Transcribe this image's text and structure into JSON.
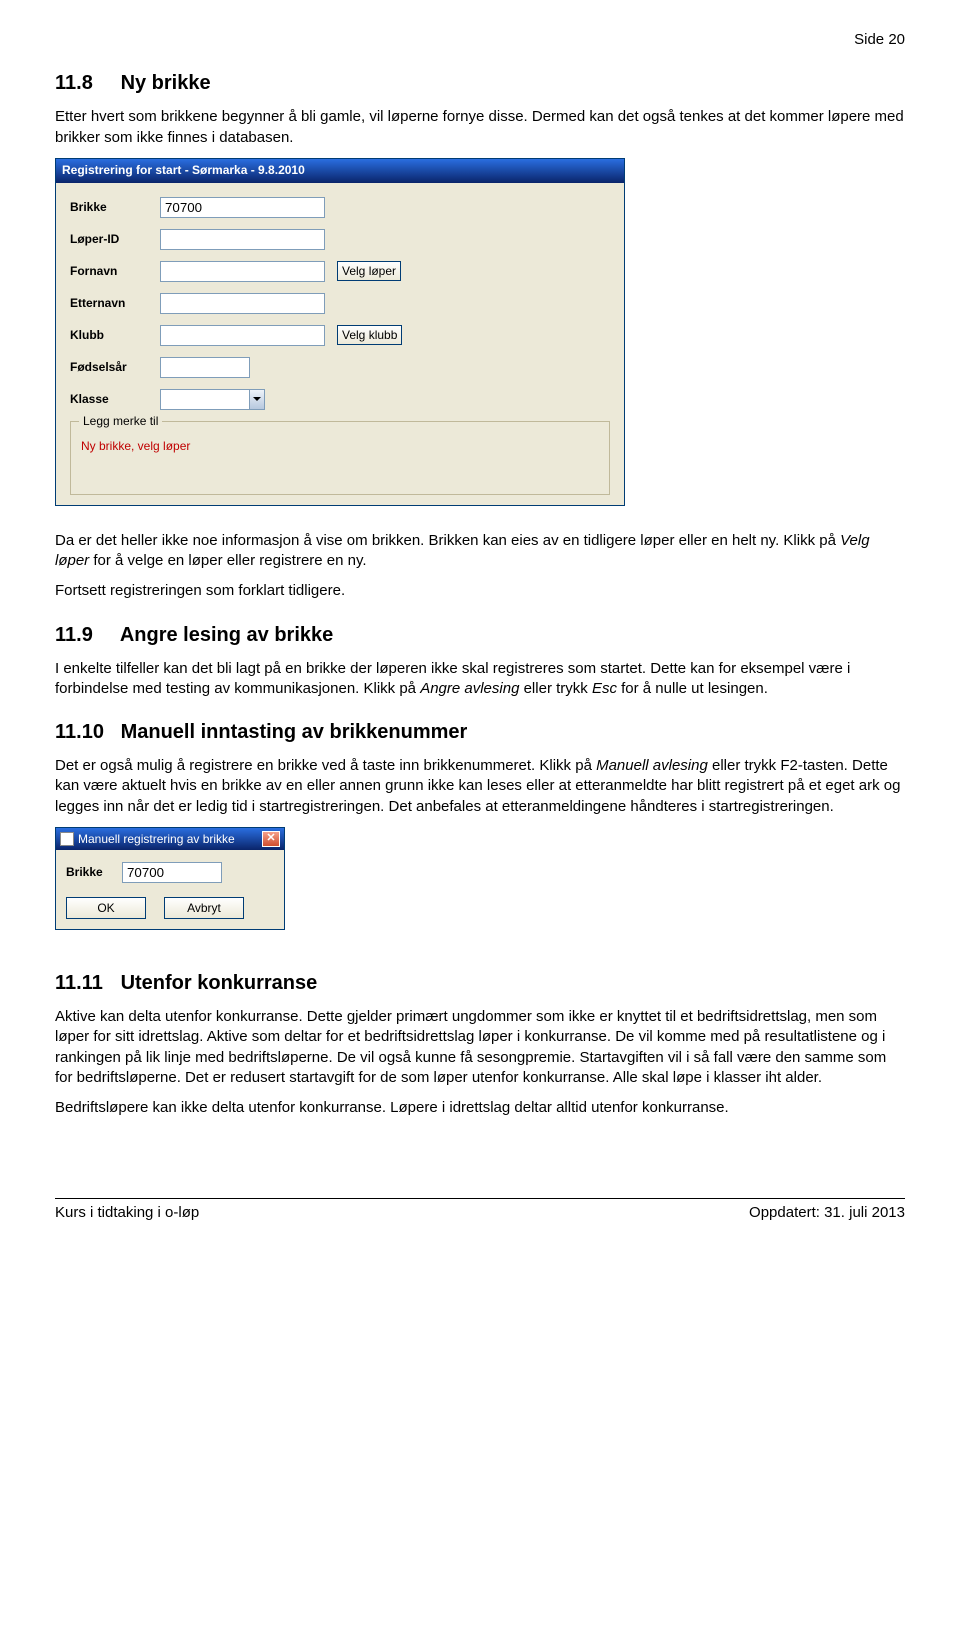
{
  "page_number": "Side 20",
  "section_11_8": {
    "number": "11.8",
    "title": "Ny brikke",
    "p1": "Etter hvert som brikkene begynner å bli gamle, vil løperne fornye disse. Dermed kan det også tenkes at det kommer løpere med brikker som ikke finnes i databasen.",
    "p2_before": "Da er det heller ikke noe informasjon å vise om brikken. Brikken kan eies av en tidligere løper eller en helt ny. Klikk på ",
    "p2_italic": "Velg løper",
    "p2_after": " for å velge en løper eller registrere en ny.",
    "p3": "Fortsett registreringen som forklart tidligere."
  },
  "reg_window": {
    "title": "Registrering for start - Sørmarka - 9.8.2010",
    "labels": {
      "brikke": "Brikke",
      "loper_id": "Løper-ID",
      "fornavn": "Fornavn",
      "etternavn": "Etternavn",
      "klubb": "Klubb",
      "fodselsar": "Fødselsår",
      "klasse": "Klasse"
    },
    "values": {
      "brikke": "70700"
    },
    "buttons": {
      "velg_loper": "Velg løper",
      "velg_klubb": "Velg klubb"
    },
    "fieldset_legend": "Legg merke til",
    "fieldset_note": "Ny brikke, velg løper"
  },
  "section_11_9": {
    "number": "11.9",
    "title": "Angre lesing av brikke",
    "p1_before": "I enkelte tilfeller kan det bli lagt på en brikke der løperen ikke skal registreres som startet. Dette kan for eksempel være i forbindelse med testing av kommunikasjonen. Klikk på ",
    "p1_italic1": "Angre avlesing",
    "p1_mid": " eller trykk ",
    "p1_italic2": "Esc",
    "p1_after": " for å nulle ut lesingen."
  },
  "section_11_10": {
    "number": "11.10",
    "title": "Manuell inntasting av brikkenummer",
    "p1_before": "Det er også mulig å registrere en brikke ved å taste inn brikkenummeret. Klikk på ",
    "p1_italic": "Manuell avlesing",
    "p1_after": " eller trykk F2-tasten. Dette kan være aktuelt hvis en brikke av en eller annen grunn ikke kan leses eller at etteranmeldte har blitt registrert på et eget ark og legges inn når det er ledig tid i startregistreringen. Det anbefales at etteranmeldingene håndteres i startregistreringen."
  },
  "small_dialog": {
    "title": "Manuell registrering av brikke",
    "label": "Brikke",
    "value": "70700",
    "ok": "OK",
    "cancel": "Avbryt"
  },
  "section_11_11": {
    "number": "11.11",
    "title": "Utenfor konkurranse",
    "p1": "Aktive kan delta utenfor konkurranse. Dette gjelder primært ungdommer som ikke er knyttet til et bedriftsidrettslag, men som løper for sitt idrettslag. Aktive som deltar for et bedriftsidrettslag løper i konkurranse. De vil komme med på resultatlistene og i rankingen på lik linje med bedriftsløperne. De vil også kunne få sesongpremie. Startavgiften vil i så fall være den samme som for bedriftsløperne. Det er redusert startavgift for de som løper utenfor konkurranse. Alle skal løpe i klasser iht alder.",
    "p2": "Bedriftsløpere kan ikke delta utenfor konkurranse. Løpere i idrettslag deltar alltid utenfor konkurranse."
  },
  "footer": {
    "left": "Kurs i tidtaking i o-løp",
    "right": "Oppdatert: 31. juli 2013"
  }
}
